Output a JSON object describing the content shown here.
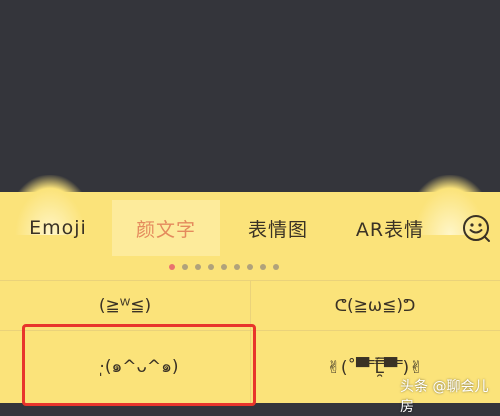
{
  "tabs": {
    "emoji": "Emoji",
    "kaomoji": "颜文字",
    "sticker": "表情图",
    "ar": "AR表情",
    "face_icon": "smiley-face-icon"
  },
  "pagination": {
    "count": 9,
    "active_index": 0
  },
  "kaomoji": [
    "(≧ᵂ≦)",
    "ᕦ(≧ω≦)ᕤ",
    "·̩(๑^ᴗ^๑)",
    "✌(˚▀̿ ̿Ĺ̯̿̿▀̿ ̿)✌"
  ],
  "watermark": "头条 @聊会儿房",
  "colors": {
    "active_tab_text": "#e48a5d",
    "active_dot": "#e9726e",
    "highlight_box": "#e8352b",
    "keyboard_bg": "#fbe37a"
  }
}
